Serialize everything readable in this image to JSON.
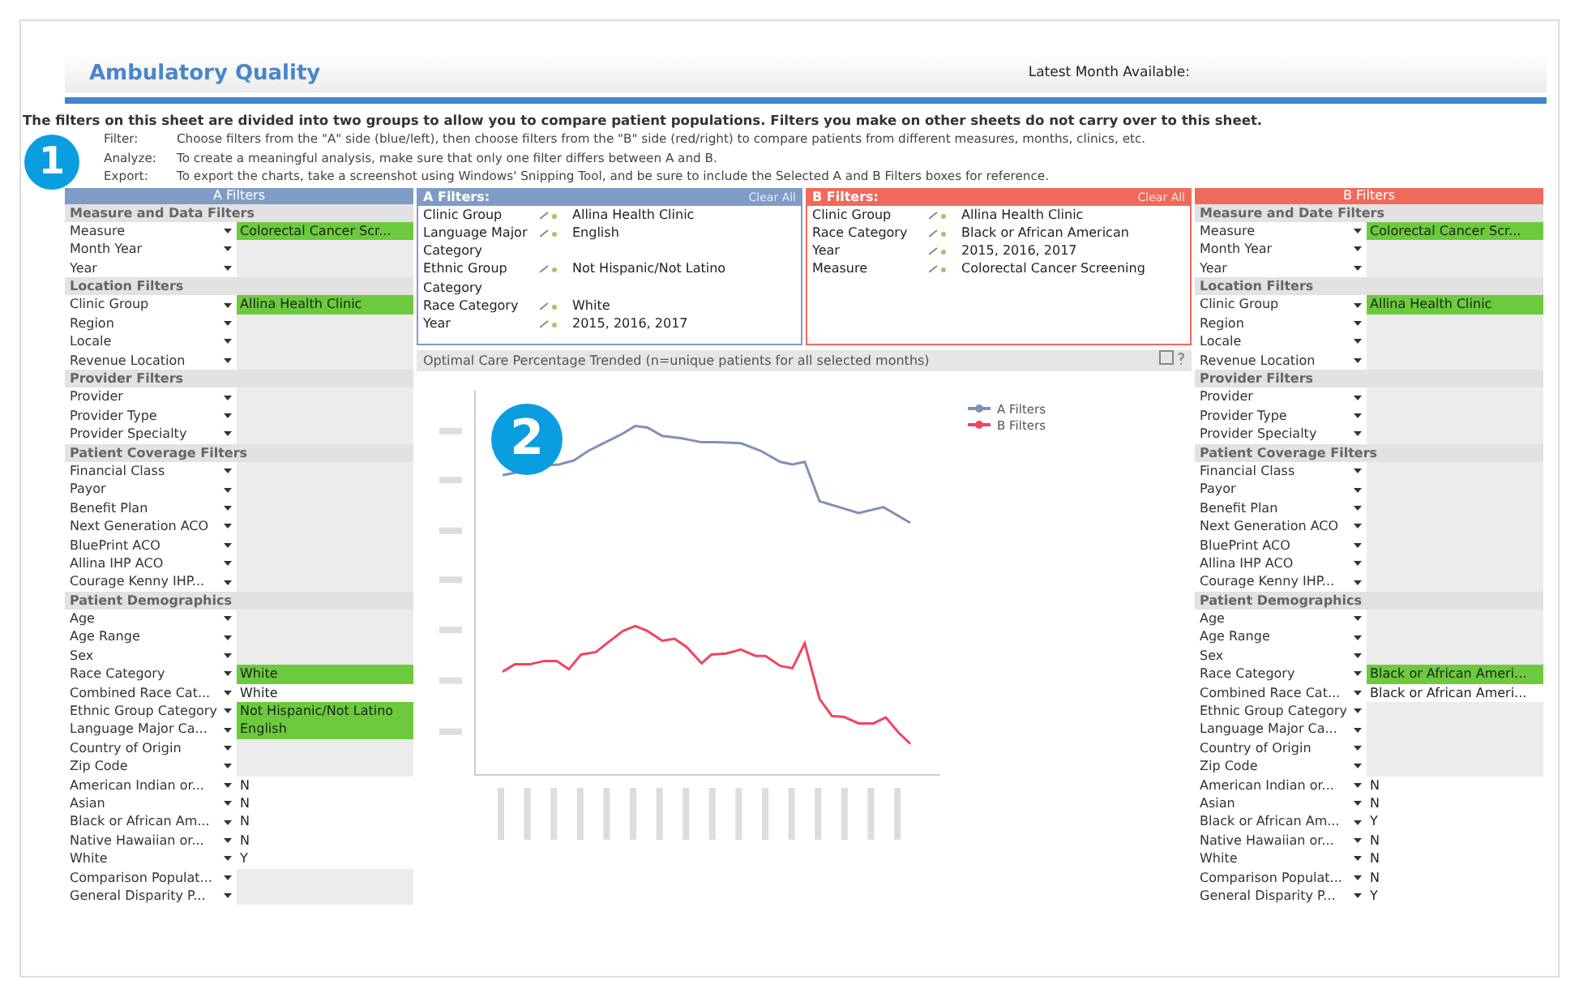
{
  "header": {
    "title": "Ambulatory Quality",
    "latest_label": "Latest Month Available:"
  },
  "intro": {
    "lead": "The filters on this sheet are divided into two groups to allow you to compare patient populations. Filters you make on other sheets do not carry over to this sheet.",
    "steps": [
      {
        "label": "Filter:",
        "text": "Choose filters from the \"A\" side (blue/left), then choose filters from the \"B\" side (red/right) to compare patients from different measures, months, clinics, etc."
      },
      {
        "label": "Analyze:",
        "text": "To create a meaningful analysis, make sure that only one filter differs between A and B."
      },
      {
        "label": "Export:",
        "text": "To export the charts, take a screenshot using Windows' Snipping Tool, and be sure to include the Selected A and B Filters boxes for reference."
      }
    ]
  },
  "callouts": [
    "1",
    "2"
  ],
  "panels": [
    {
      "color": "#7f9cc6",
      "title": "A Filters",
      "sections": [
        {
          "title": "Measure and Data Filters",
          "rows": [
            {
              "label": "Measure",
              "value": "Colorectal Cancer Scr...",
              "highlighted": true
            },
            {
              "label": "Month Year",
              "highlighted": false
            },
            {
              "label": "Year",
              "highlighted": false
            }
          ]
        },
        {
          "title": "Location Filters",
          "rows": [
            {
              "label": "Clinic Group",
              "value": "Allina Health Clinic",
              "highlighted": true
            },
            {
              "label": "Region",
              "highlighted": false
            },
            {
              "label": "Locale",
              "highlighted": false
            },
            {
              "label": "Revenue Location",
              "highlighted": false
            }
          ]
        },
        {
          "title": "Provider Filters",
          "rows": [
            {
              "label": "Provider",
              "highlighted": false
            },
            {
              "label": "Provider Type",
              "highlighted": false
            },
            {
              "label": "Provider Specialty",
              "highlighted": false
            }
          ]
        },
        {
          "title": "Patient Coverage Filters",
          "rows": [
            {
              "label": "Financial Class",
              "highlighted": false
            },
            {
              "label": "Payor",
              "highlighted": false
            },
            {
              "label": "Benefit Plan",
              "highlighted": false
            },
            {
              "label": "Next Generation ACO",
              "highlighted": false
            },
            {
              "label": "BluePrint ACO",
              "highlighted": false
            },
            {
              "label": "Allina IHP ACO",
              "highlighted": false
            },
            {
              "label": "Courage Kenny IHP...",
              "highlighted": false
            }
          ]
        },
        {
          "title": "Patient Demographics",
          "rows": [
            {
              "label": "Age",
              "highlighted": false
            },
            {
              "label": "Age Range",
              "highlighted": false
            },
            {
              "label": "Sex",
              "highlighted": false
            },
            {
              "label": "Race Category",
              "value": "White",
              "highlighted": true
            },
            {
              "label": "Combined Race Cat...",
              "value": "White",
              "highlighted": false
            },
            {
              "label": "Ethnic Group Category",
              "value": "Not Hispanic/Not Latino",
              "highlighted": true
            },
            {
              "label": "Language Major Ca...",
              "value": "English",
              "highlighted": true
            },
            {
              "label": "Country of Origin",
              "highlighted": false
            },
            {
              "label": "Zip Code",
              "highlighted": false
            },
            {
              "label": "American Indian or...",
              "value": "N",
              "highlighted": false
            },
            {
              "label": "Asian",
              "value": "N",
              "highlighted": false
            },
            {
              "label": "Black or African Am...",
              "value": "N",
              "highlighted": false
            },
            {
              "label": "Native Hawaiian or...",
              "value": "N",
              "highlighted": false
            },
            {
              "label": "White",
              "value": "Y",
              "highlighted": false
            },
            {
              "label": "Comparison Populat...",
              "highlighted": false
            },
            {
              "label": "General Disparity P...",
              "highlighted": false
            }
          ]
        }
      ]
    },
    {
      "color": "#f06a5c",
      "title": "B Filters",
      "sections": [
        {
          "title": "Measure and Date Filters",
          "rows": [
            {
              "label": "Measure",
              "value": "Colorectal Cancer Scr...",
              "highlighted": true
            },
            {
              "label": "Month Year",
              "highlighted": false
            },
            {
              "label": "Year",
              "highlighted": false
            }
          ]
        },
        {
          "title": "Location Filters",
          "rows": [
            {
              "label": "Clinic Group",
              "value": "Allina Health Clinic",
              "highlighted": true
            },
            {
              "label": "Region",
              "highlighted": false
            },
            {
              "label": "Locale",
              "highlighted": false
            },
            {
              "label": "Revenue Location",
              "highlighted": false
            }
          ]
        },
        {
          "title": "Provider Filters",
          "rows": [
            {
              "label": "Provider",
              "highlighted": false
            },
            {
              "label": "Provider Type",
              "highlighted": false
            },
            {
              "label": "Provider Specialty",
              "highlighted": false
            }
          ]
        },
        {
          "title": "Patient Coverage Filters",
          "rows": [
            {
              "label": "Financial Class",
              "highlighted": false
            },
            {
              "label": "Payor",
              "highlighted": false
            },
            {
              "label": "Benefit Plan",
              "highlighted": false
            },
            {
              "label": "Next Generation ACO",
              "highlighted": false
            },
            {
              "label": "BluePrint ACO",
              "highlighted": false
            },
            {
              "label": "Allina IHP ACO",
              "highlighted": false
            },
            {
              "label": "Courage Kenny IHP...",
              "highlighted": false
            }
          ]
        },
        {
          "title": "Patient Demographics",
          "rows": [
            {
              "label": "Age",
              "highlighted": false
            },
            {
              "label": "Age Range",
              "highlighted": false
            },
            {
              "label": "Sex",
              "highlighted": false
            },
            {
              "label": "Race Category",
              "value": "Black or African Ameri...",
              "highlighted": true
            },
            {
              "label": "Combined Race Cat...",
              "value": "Black or African Ameri...",
              "highlighted": false
            },
            {
              "label": "Ethnic Group Category",
              "highlighted": false
            },
            {
              "label": "Language Major Ca...",
              "highlighted": false
            },
            {
              "label": "Country of Origin",
              "highlighted": false
            },
            {
              "label": "Zip Code",
              "highlighted": false
            },
            {
              "label": "American Indian or...",
              "value": "N",
              "highlighted": false
            },
            {
              "label": "Asian",
              "value": "N",
              "highlighted": false
            },
            {
              "label": "Black or African Am...",
              "value": "Y",
              "highlighted": false
            },
            {
              "label": "Native Hawaiian or...",
              "value": "N",
              "highlighted": false
            },
            {
              "label": "White",
              "value": "N",
              "highlighted": false
            },
            {
              "label": "Comparison Populat...",
              "value": "N",
              "highlighted": false
            },
            {
              "label": "General Disparity P...",
              "value": "Y",
              "highlighted": false
            }
          ]
        }
      ]
    }
  ],
  "selections": [
    {
      "color": "#7f9cc6",
      "title": "A Filters:",
      "clear": "Clear All",
      "items": [
        {
          "field": "Clinic Group",
          "value": "Allina Health Clinic"
        },
        {
          "field": "Language Major Category",
          "value": "English"
        },
        {
          "field": "Ethnic Group Category",
          "value": "Not Hispanic/Not Latino"
        },
        {
          "field": "Race Category",
          "value": "White"
        },
        {
          "field": "Year",
          "value": "2015, 2016, 2017"
        }
      ]
    },
    {
      "color": "#f06a5c",
      "title": "B Filters:",
      "clear": "Clear All",
      "items": [
        {
          "field": "Clinic Group",
          "value": "Allina Health Clinic"
        },
        {
          "field": "Race Category",
          "value": "Black or African American"
        },
        {
          "field": "Year",
          "value": "2015, 2016, 2017"
        },
        {
          "field": "Measure",
          "value": "Colorectal Cancer Screening"
        }
      ]
    }
  ],
  "chart": {
    "title": "Optimal Care Percentage Trended (n=unique patients for all selected months)",
    "legend": [
      {
        "label": "A Filters",
        "color": "#8090b8"
      },
      {
        "label": "B Filters",
        "color": "#f0455f"
      }
    ]
  }
}
